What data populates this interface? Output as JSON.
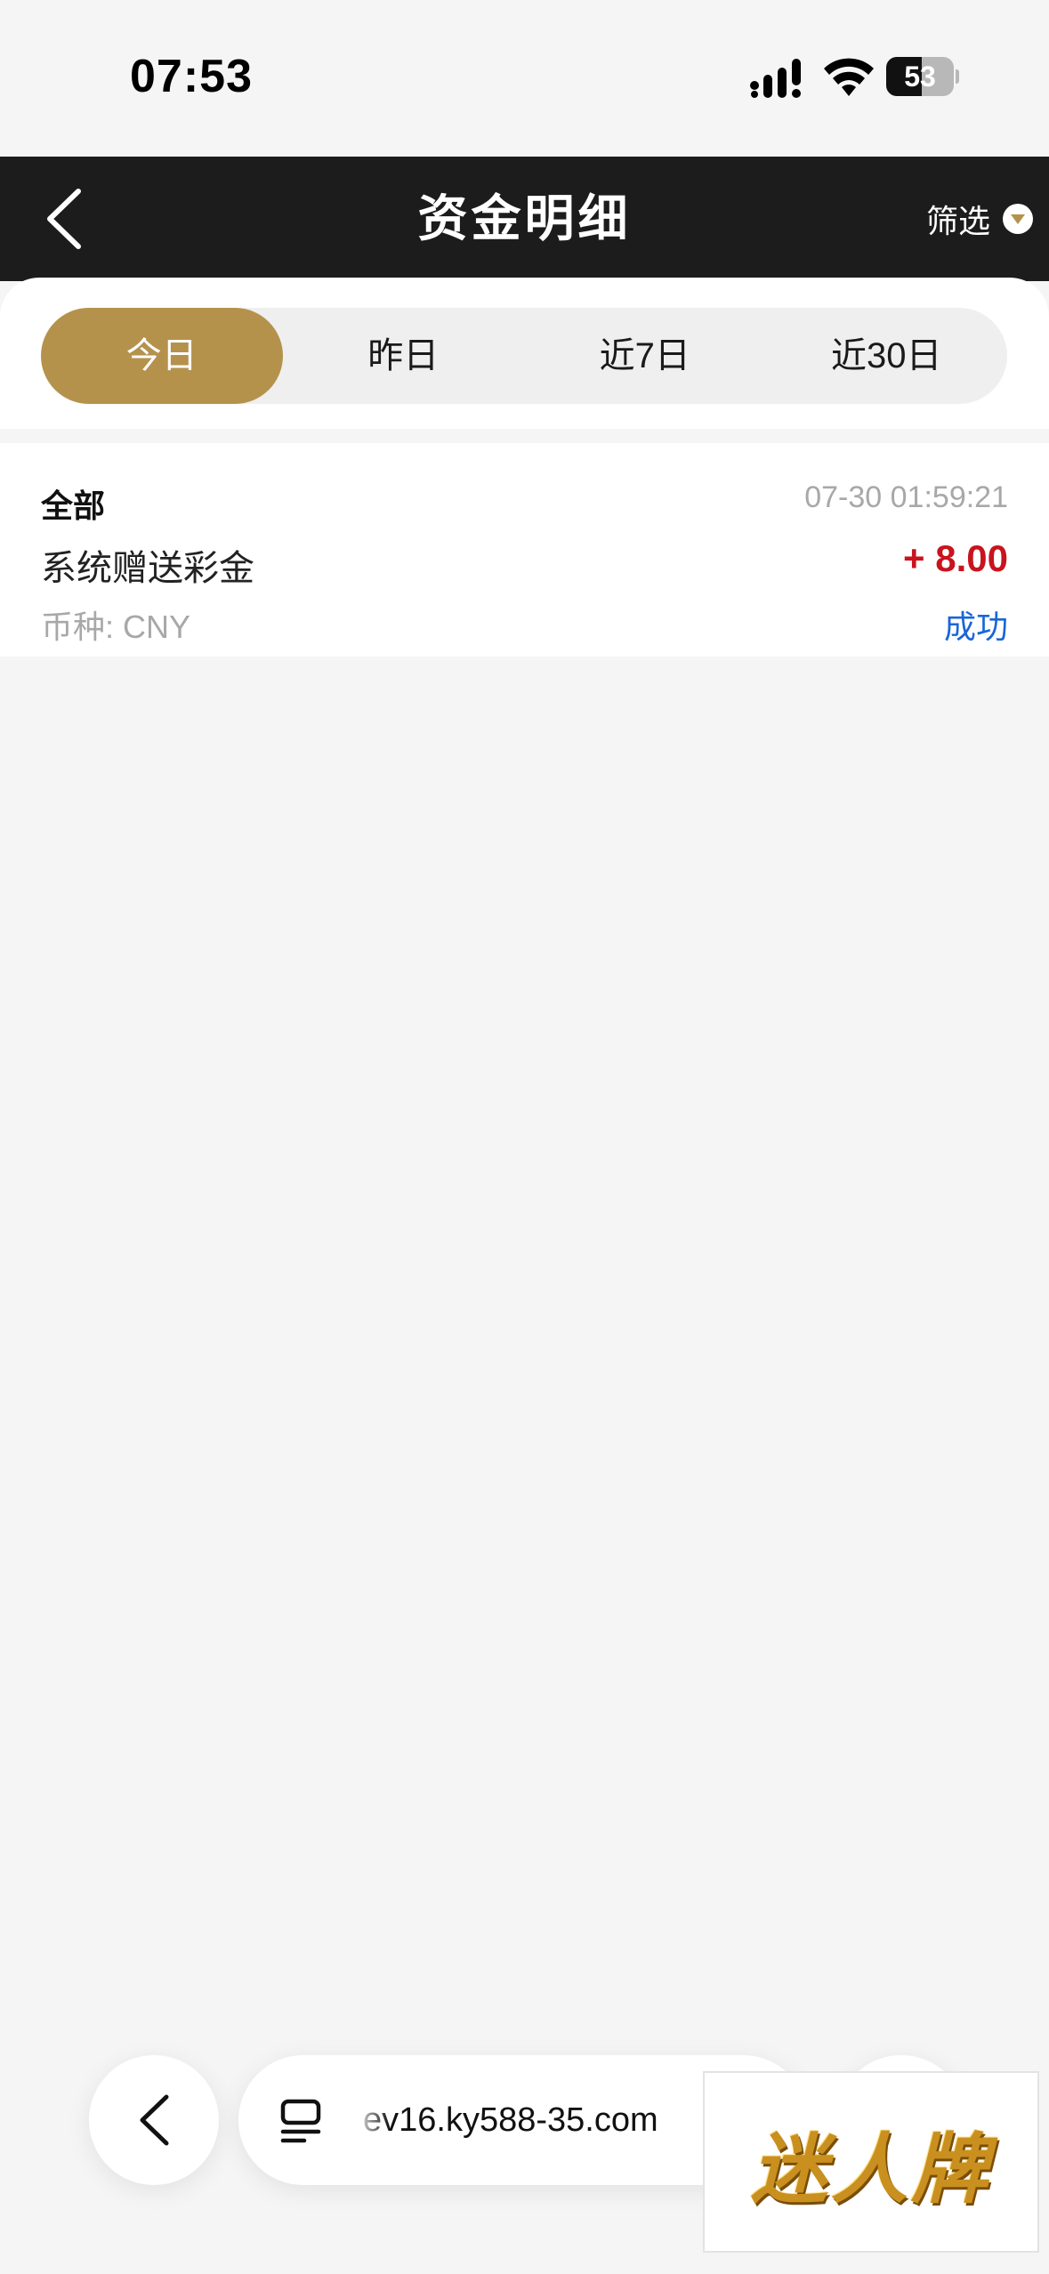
{
  "status_bar": {
    "time": "07:53",
    "battery": "53",
    "battery_level_percent": 53
  },
  "navbar": {
    "back_icon": "chevron-left-icon",
    "title": "资金明细",
    "filter_label": "筛选",
    "filter_icon": "chevron-down-icon"
  },
  "tabs": [
    {
      "label": "今日",
      "active": true
    },
    {
      "label": "昨日",
      "active": false
    },
    {
      "label": "近7日",
      "active": false
    },
    {
      "label": "近30日",
      "active": false
    }
  ],
  "records": [
    {
      "category": "全部",
      "time": "07-30 01:59:21",
      "description": "系统赠送彩金",
      "amount": "+ 8.00",
      "currency": "币种: CNY",
      "status": "成功"
    }
  ],
  "browser": {
    "url": "ev16.ky588-35.com"
  },
  "ad": {
    "text": "迷人牌"
  },
  "colors": {
    "accent": "#b5924c",
    "navbar": "#1c1c1c",
    "amount": "#c8141e",
    "status": "#1a66d6"
  }
}
